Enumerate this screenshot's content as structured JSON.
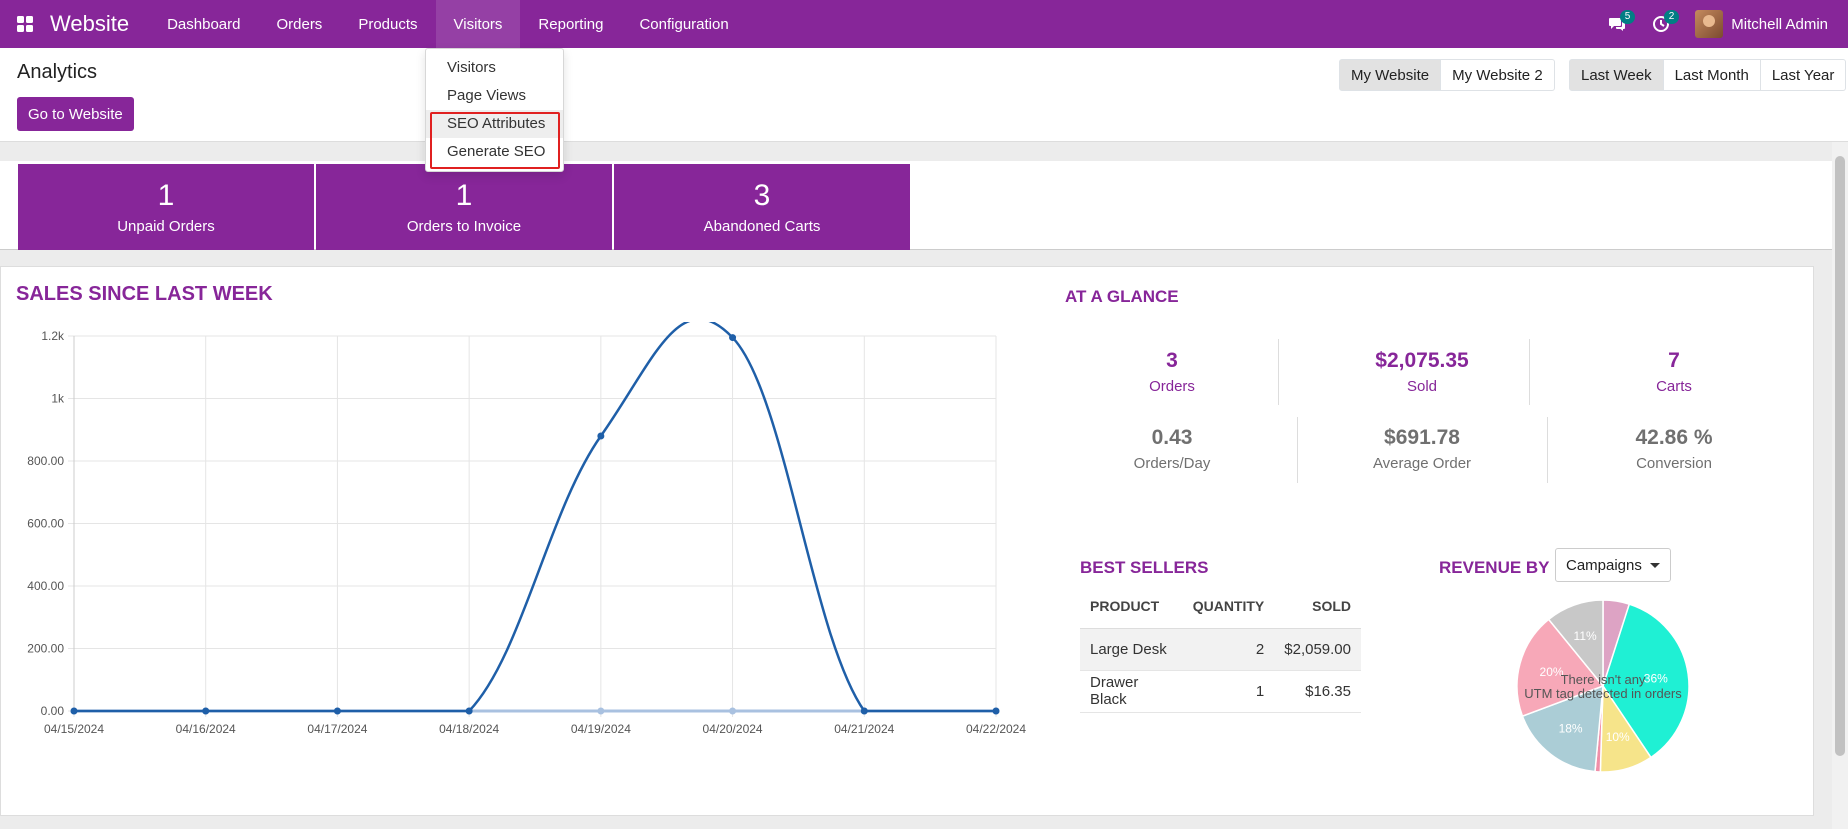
{
  "navbar": {
    "app_name": "Website",
    "menu": [
      "Dashboard",
      "Orders",
      "Products",
      "Visitors",
      "Reporting",
      "Configuration"
    ],
    "active_menu": "Visitors",
    "messages_count": "5",
    "activities_count": "2",
    "user_name": "Mitchell Admin"
  },
  "control": {
    "title": "Analytics",
    "go_button": "Go to Website",
    "websites": [
      "My Website",
      "My Website 2"
    ],
    "selected_website": "My Website",
    "periods": [
      "Last Week",
      "Last Month",
      "Last Year"
    ],
    "selected_period": "Last Week"
  },
  "visitors_dropdown": {
    "items": [
      "Visitors",
      "Page Views",
      "SEO Attributes",
      "Generate SEO"
    ],
    "highlighted": [
      "SEO Attributes",
      "Generate SEO"
    ]
  },
  "kpis": [
    {
      "value": "1",
      "label": "Unpaid Orders"
    },
    {
      "value": "1",
      "label": "Orders to Invoice"
    },
    {
      "value": "3",
      "label": "Abandoned Carts"
    }
  ],
  "sales": {
    "title": "SALES SINCE LAST WEEK"
  },
  "chart_data": {
    "type": "line",
    "title": "SALES SINCE LAST WEEK",
    "x": [
      "04/15/2024",
      "04/16/2024",
      "04/17/2024",
      "04/18/2024",
      "04/19/2024",
      "04/20/2024",
      "04/21/2024",
      "04/22/2024"
    ],
    "series": [
      {
        "values": [
          0,
          0,
          0,
          0,
          880,
          1195,
          0,
          0
        ],
        "color": "#1f5fa8"
      },
      {
        "values": [
          0,
          0,
          0,
          0,
          0,
          0,
          0,
          0
        ],
        "color": "#a9c1e0"
      }
    ],
    "ylim": [
      0,
      1200
    ],
    "yticks": [
      "0.00",
      "200.00",
      "400.00",
      "600.00",
      "800.00",
      "1k",
      "1.2k"
    ],
    "grid": true
  },
  "glance": {
    "title": "AT A GLANCE",
    "top": [
      {
        "value": "3",
        "label": "Orders"
      },
      {
        "value": "$2,075.35",
        "label": "Sold"
      },
      {
        "value": "7",
        "label": "Carts"
      }
    ],
    "bottom": [
      {
        "value": "0.43",
        "label": "Orders/Day"
      },
      {
        "value": "$691.78",
        "label": "Average Order"
      },
      {
        "value": "42.86 %",
        "label": "Conversion"
      }
    ]
  },
  "best_sellers": {
    "title": "BEST SELLERS",
    "headers": [
      "PRODUCT",
      "QUANTITY",
      "SOLD"
    ],
    "rows": [
      [
        "Large Desk",
        "2",
        "$2,059.00"
      ],
      [
        "Drawer Black",
        "1",
        "$16.35"
      ]
    ]
  },
  "revenue": {
    "title": "REVENUE BY",
    "dropdown": "Campaigns",
    "empty_line1": "There isn't any",
    "empty_line2": "UTM tag detected in orders",
    "pie": [
      {
        "value": 5,
        "color": "#dda3c4",
        "label": ""
      },
      {
        "value": 36,
        "color": "#1ff0d4",
        "label": "36%"
      },
      {
        "value": 10,
        "color": "#f6e48a",
        "label": "10%"
      },
      {
        "value": 1,
        "color": "#f08fa8",
        "label": ""
      },
      {
        "value": 18,
        "color": "#abcdd6",
        "label": "18%"
      },
      {
        "value": 20,
        "color": "#f7a8b8",
        "label": "20%"
      },
      {
        "value": 11,
        "color": "#c8c8c8",
        "label": "11%"
      }
    ]
  }
}
